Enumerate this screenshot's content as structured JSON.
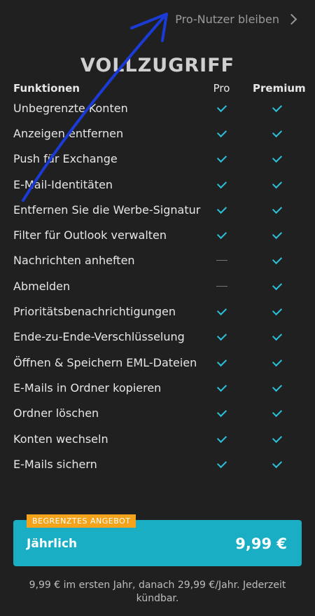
{
  "topbar": {
    "stay_pro": "Pro-Nutzer bleiben"
  },
  "title": "VOLLZUGRIFF",
  "table": {
    "header": {
      "features": "Funktionen",
      "pro": "Pro",
      "premium": "Premium"
    },
    "rows": [
      {
        "label": "Unbegrenzte Konten",
        "pro": true,
        "premium": true
      },
      {
        "label": "Anzeigen entfernen",
        "pro": true,
        "premium": true
      },
      {
        "label": "Push für Exchange",
        "pro": true,
        "premium": true
      },
      {
        "label": "E-Mail-Identitäten",
        "pro": true,
        "premium": true
      },
      {
        "label": "Entfernen Sie die Werbe-Signatur",
        "pro": true,
        "premium": true
      },
      {
        "label": "Filter für Outlook verwalten",
        "pro": true,
        "premium": true
      },
      {
        "label": "Nachrichten anheften",
        "pro": false,
        "premium": true
      },
      {
        "label": "Abmelden",
        "pro": false,
        "premium": true
      },
      {
        "label": "Prioritätsbenachrichtigungen",
        "pro": true,
        "premium": true
      },
      {
        "label": "Ende-zu-Ende-Verschlüsselung",
        "pro": true,
        "premium": true
      },
      {
        "label": "Öffnen & Speichern EML-Dateien",
        "pro": true,
        "premium": true
      },
      {
        "label": "E-Mails in Ordner kopieren",
        "pro": true,
        "premium": true
      },
      {
        "label": "Ordner löschen",
        "pro": true,
        "premium": true
      },
      {
        "label": "Konten wechseln",
        "pro": true,
        "premium": true
      },
      {
        "label": "E-Mails sichern",
        "pro": true,
        "premium": true
      }
    ]
  },
  "offer": {
    "badge": "BEGRENZTES ANGEBOT",
    "plan": "Jährlich",
    "price": "9,99 €"
  },
  "footer": {
    "note": "9,99 € im ersten Jahr, danach 29,99 €/Jahr. Jederzeit kündbar."
  },
  "colors": {
    "accent": "#19aec4",
    "badge": "#f5a31a",
    "check": "#2bc0d8",
    "annotation": "#1b3bd6"
  }
}
